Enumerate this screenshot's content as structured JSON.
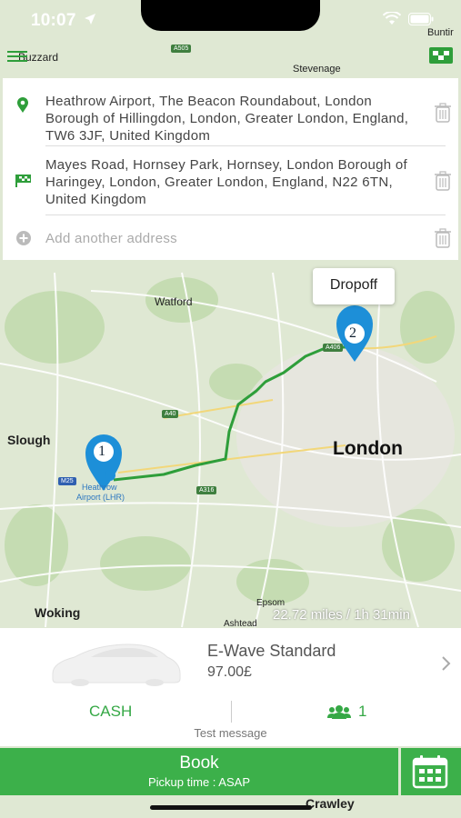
{
  "status": {
    "time": "10:07"
  },
  "map_labels": {
    "buzzard": "Buzzard",
    "stevenage": "Stevenage",
    "buntin": "Buntir",
    "watford": "Watford",
    "slough": "Slough",
    "london": "London",
    "woking": "Woking",
    "epsom": "Epsom",
    "ashtead": "Ashtead",
    "crawley": "Crawley",
    "heathrow_line1": "Heathrow",
    "heathrow_line2": "Airport (LHR)",
    "road_a505": "A505",
    "road_a406": "A406",
    "road_a40": "A40",
    "road_m25": "M25",
    "road_a316": "A316"
  },
  "addresses": {
    "pickup": "Heathrow Airport, The Beacon Roundabout, London Borough of Hillingdon, London, Greater London, England, TW6 3JF, United Kingdom",
    "dropoff": "Mayes Road, Hornsey Park, Hornsey, London Borough of Haringey, London, Greater London, England, N22 6TN, United Kingdom",
    "add_placeholder": "Add another address"
  },
  "markers": {
    "pickup_number": "1",
    "dropoff_number": "2",
    "dropoff_tooltip": "Dropoff"
  },
  "route": {
    "distance_time": "22.72 miles / 1h 31min"
  },
  "vehicle": {
    "name": "E-Wave Standard",
    "price": "97.00£"
  },
  "payment": {
    "method": "CASH"
  },
  "passengers": {
    "count": "1"
  },
  "message": "Test message",
  "book": {
    "label": "Book",
    "pickup_time": "Pickup time : ASAP"
  },
  "colors": {
    "accent": "#3cb04a",
    "marker": "#1d8fd8",
    "route": "#2e9e3a"
  }
}
